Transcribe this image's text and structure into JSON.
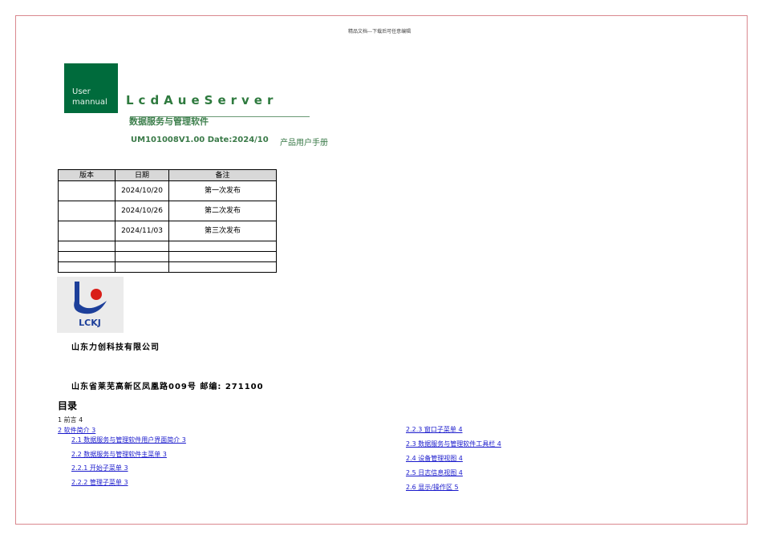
{
  "header_note": "精品文档---下载后可任意编辑",
  "cover": {
    "badge_line1": "User",
    "badge_line2": "mannual",
    "title": "LcdAueServer",
    "subtitle": "数据服务与管理软件",
    "doc_id": "UM101008V1.00  Date:2024/10",
    "doc_type": "产品用户手册"
  },
  "revision_table": {
    "headers": [
      "版本",
      "日期",
      "备注"
    ],
    "rows": [
      [
        "",
        "2024/10/20",
        "第一次发布"
      ],
      [
        "",
        "2024/10/26",
        "第二次发布"
      ],
      [
        "",
        "2024/11/03",
        "第三次发布"
      ],
      [
        "",
        "",
        ""
      ],
      [
        "",
        "",
        ""
      ],
      [
        "",
        "",
        ""
      ]
    ]
  },
  "company": {
    "logo_text": "LCKJ",
    "name": "山东力创科技有限公司",
    "address": "山东省莱芜高新区凤凰路009号    邮编: 271100"
  },
  "toc": {
    "title": "目录",
    "items": [
      "1 前言 4",
      "2  软件简介 3",
      "2.1   数据服务与管理软件用户界面简介 3",
      "2.2   数据服务与管理软件主菜单 3",
      "2.2.1  开始子菜单 3",
      "2.2.2  管理子菜单 3",
      "2.2.3  窗口子菜单 4",
      "2.3   数据服务与管理软件工具栏 4",
      "2.4   设备管理视图 4",
      "2.5   日志信息视图 4",
      "2.6   显示/操作区 5"
    ]
  }
}
